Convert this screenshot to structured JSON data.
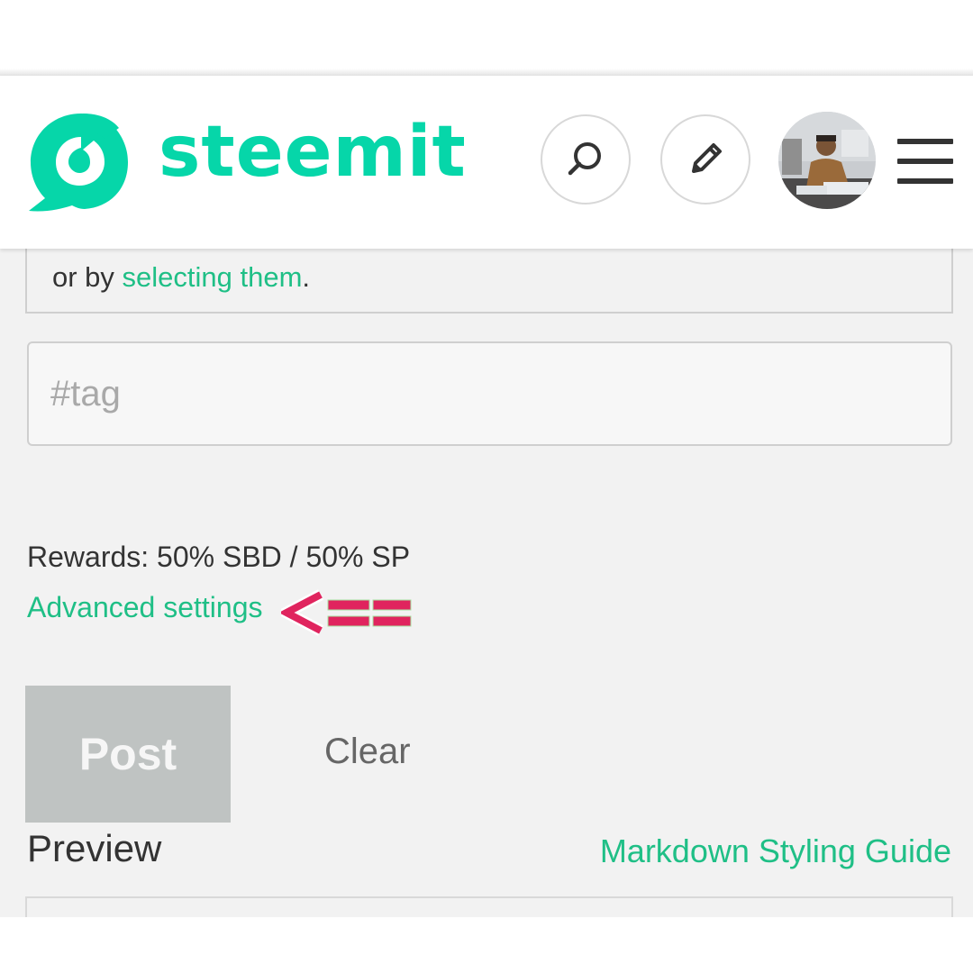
{
  "header": {
    "logo_text": "steemit",
    "brand_color": "#06d6a9",
    "search_icon": "search-icon",
    "edit_icon": "pencil-icon",
    "menu_icon": "hamburger-menu-icon"
  },
  "tags_hint": {
    "prefix": "or by ",
    "link": "selecting them",
    "suffix": "."
  },
  "tag_input": {
    "placeholder": "#tag",
    "value": ""
  },
  "rewards": {
    "text": "Rewards: 50% SBD / 50% SP"
  },
  "advanced": {
    "label": "Advanced settings"
  },
  "annotation": {
    "arrow_color": "#e0245e"
  },
  "actions": {
    "post_label": "Post",
    "clear_label": "Clear"
  },
  "preview": {
    "title": "Preview",
    "guide_link": "Markdown Styling Guide"
  }
}
